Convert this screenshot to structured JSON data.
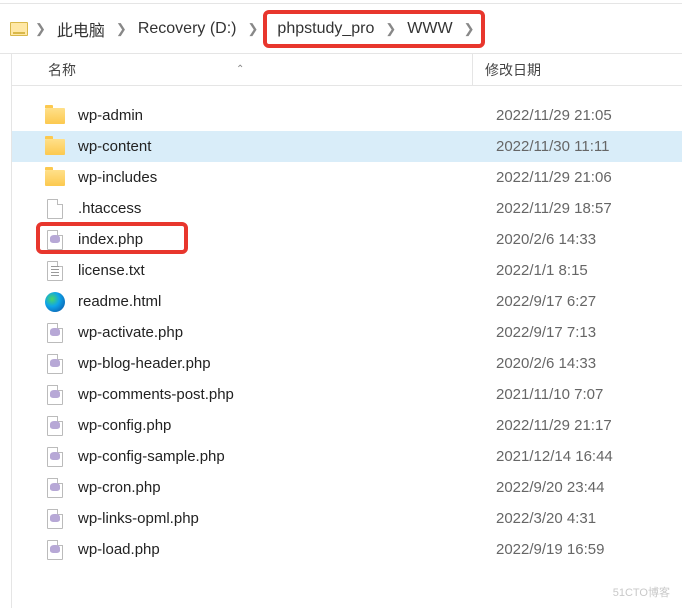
{
  "breadcrumb": {
    "items": [
      {
        "label": "此电脑",
        "icon": "drive-icon"
      },
      {
        "label": "Recovery (D:)"
      },
      {
        "label": "phpstudy_pro",
        "highlighted": true
      },
      {
        "label": "WWW",
        "highlighted": true
      }
    ]
  },
  "columns": {
    "name": "名称",
    "date": "修改日期"
  },
  "files": [
    {
      "name": "wp-admin",
      "date": "2022/11/29 21:05",
      "type": "folder"
    },
    {
      "name": "wp-content",
      "date": "2022/11/30 11:11",
      "type": "folder",
      "selected": true
    },
    {
      "name": "wp-includes",
      "date": "2022/11/29 21:06",
      "type": "folder"
    },
    {
      "name": ".htaccess",
      "date": "2022/11/29 18:57",
      "type": "file"
    },
    {
      "name": "index.php",
      "date": "2020/2/6 14:33",
      "type": "php",
      "highlighted": true
    },
    {
      "name": "license.txt",
      "date": "2022/1/1 8:15",
      "type": "txt"
    },
    {
      "name": "readme.html",
      "date": "2022/9/17 6:27",
      "type": "html"
    },
    {
      "name": "wp-activate.php",
      "date": "2022/9/17 7:13",
      "type": "php"
    },
    {
      "name": "wp-blog-header.php",
      "date": "2020/2/6 14:33",
      "type": "php"
    },
    {
      "name": "wp-comments-post.php",
      "date": "2021/11/10 7:07",
      "type": "php"
    },
    {
      "name": "wp-config.php",
      "date": "2022/11/29 21:17",
      "type": "php"
    },
    {
      "name": "wp-config-sample.php",
      "date": "2021/12/14 16:44",
      "type": "php"
    },
    {
      "name": "wp-cron.php",
      "date": "2022/9/20 23:44",
      "type": "php"
    },
    {
      "name": "wp-links-opml.php",
      "date": "2022/3/20 4:31",
      "type": "php"
    },
    {
      "name": "wp-load.php",
      "date": "2022/9/19 16:59",
      "type": "php"
    }
  ],
  "watermark": "51CTO博客"
}
